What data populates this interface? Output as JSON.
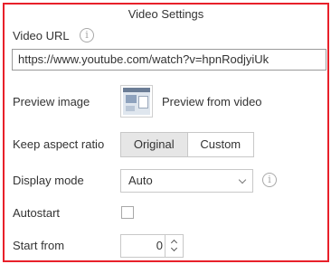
{
  "panel": {
    "title": "Video Settings",
    "border_color": "#e8202a"
  },
  "video_url": {
    "label": "Video URL",
    "value": "https://www.youtube.com/watch?v=hpnRodjyiUk",
    "info_icon": "info-icon"
  },
  "preview_image": {
    "label": "Preview image",
    "caption": "Preview from video",
    "icon": "video-thumbnail"
  },
  "aspect_ratio": {
    "label": "Keep aspect ratio",
    "options": [
      "Original",
      "Custom"
    ],
    "selected": "Original"
  },
  "display_mode": {
    "label": "Display mode",
    "value": "Auto",
    "info_icon": "info-icon"
  },
  "autostart": {
    "label": "Autostart",
    "checked": false
  },
  "start_from": {
    "label": "Start from",
    "value": "0"
  }
}
